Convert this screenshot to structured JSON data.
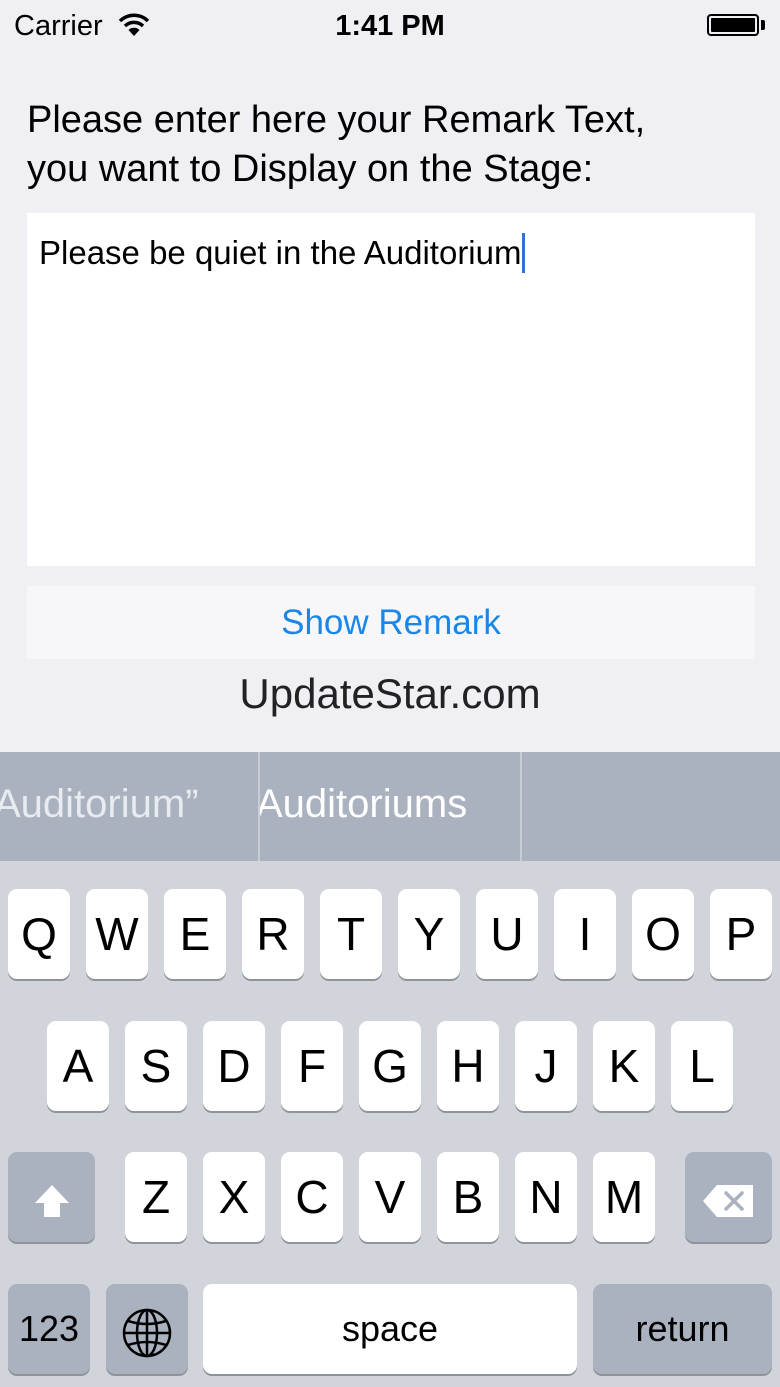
{
  "status_bar": {
    "carrier": "Carrier",
    "time": "1:41 PM",
    "wifi_icon": "wifi-icon",
    "battery_icon": "battery-icon"
  },
  "prompt": {
    "line1": "Please enter here your Remark Text,",
    "line2": "you want to Display on the Stage:"
  },
  "remark_field": {
    "value": "Please be quiet in the Auditorium"
  },
  "show_button": {
    "label": "Show Remark"
  },
  "watermark": "UpdateStar.com",
  "predictions": [
    "Auditorium”",
    "Auditoriums",
    ""
  ],
  "keyboard": {
    "row1": [
      "Q",
      "W",
      "E",
      "R",
      "T",
      "Y",
      "U",
      "I",
      "O",
      "P"
    ],
    "row2": [
      "A",
      "S",
      "D",
      "F",
      "G",
      "H",
      "J",
      "K",
      "L"
    ],
    "row3": [
      "Z",
      "X",
      "C",
      "V",
      "B",
      "N",
      "M"
    ],
    "numbers_label": "123",
    "space_label": "space",
    "return_label": "return",
    "shift_icon": "shift-icon",
    "delete_icon": "delete-icon",
    "globe_icon": "globe-icon"
  },
  "colors": {
    "accent": "#1a87e8",
    "caret": "#3a6dd8",
    "keyboard_bg": "#d1d5db",
    "predict_bg": "#aab2bf"
  }
}
